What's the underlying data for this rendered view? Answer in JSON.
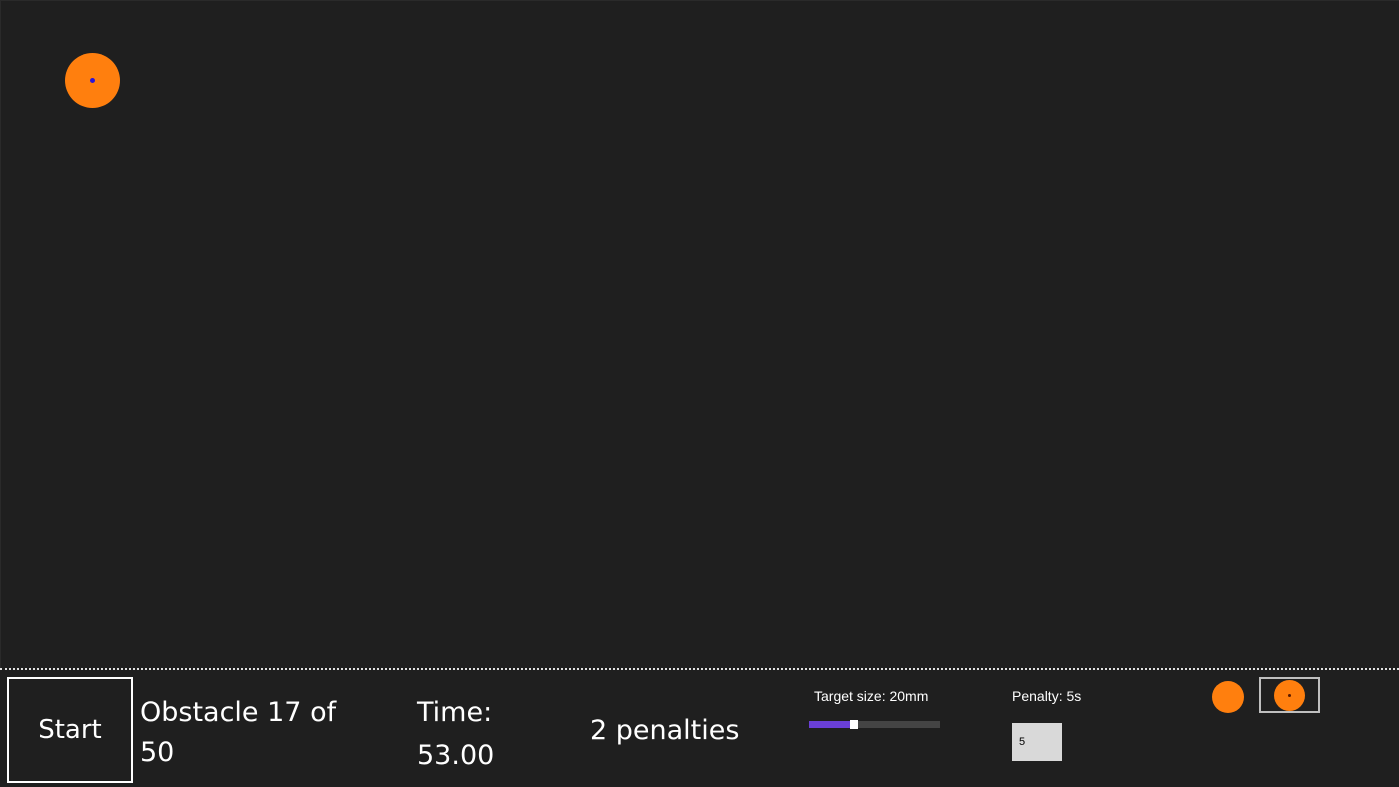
{
  "colors": {
    "background": "#1f1f1f",
    "target": "#ff7f0e",
    "target_center": "#2a16d8",
    "slider_fill": "#6a3fd6",
    "mode_dot_center": "#5a1a00"
  },
  "game": {
    "target_icon": "target-circle-icon"
  },
  "controls": {
    "start_label": "Start",
    "obstacle_text": "Obstacle 17 of 50",
    "time_label": "Time:",
    "time_value": "53.00",
    "penalties_text": "2 penalties",
    "target_size_label": "Target size: 20mm",
    "target_size_fraction": 0.34,
    "penalty_label": "Penalty: 5s",
    "penalty_value": "5",
    "mode_plain_icon": "plain-circle-icon",
    "mode_dot_icon": "dotted-circle-icon"
  }
}
